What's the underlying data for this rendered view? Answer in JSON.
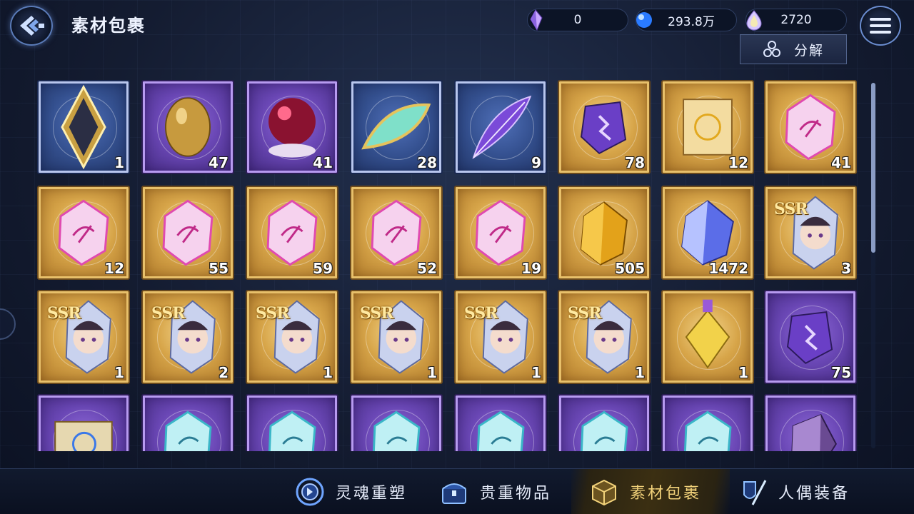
{
  "header": {
    "title": "素材包裹",
    "decompose_label": "分解"
  },
  "currencies": [
    {
      "icon": "crystal-shard-icon",
      "value": "0"
    },
    {
      "icon": "blue-orb-icon",
      "value": "293.8万"
    },
    {
      "icon": "gem-drop-icon",
      "value": "2720"
    }
  ],
  "items": [
    {
      "name": "mirror-frame",
      "rarity": "blue",
      "count": "1"
    },
    {
      "name": "golden-egg",
      "rarity": "purple",
      "count": "47"
    },
    {
      "name": "crimson-orb",
      "rarity": "purple",
      "count": "41"
    },
    {
      "name": "jade-leaf",
      "rarity": "blue",
      "count": "28"
    },
    {
      "name": "violet-quill",
      "rarity": "blue",
      "count": "9"
    },
    {
      "name": "purple-rune-stone",
      "rarity": "gold",
      "count": "78"
    },
    {
      "name": "golden-scroll",
      "rarity": "gold",
      "count": "12"
    },
    {
      "name": "pink-rune-crystal",
      "rarity": "gold",
      "count": "41"
    },
    {
      "name": "pink-rune-crystal",
      "rarity": "gold",
      "count": "12"
    },
    {
      "name": "pink-rune-crystal",
      "rarity": "gold",
      "count": "55"
    },
    {
      "name": "pink-rune-crystal",
      "rarity": "gold",
      "count": "59"
    },
    {
      "name": "pink-rune-crystal",
      "rarity": "gold",
      "count": "52"
    },
    {
      "name": "pink-rune-crystal",
      "rarity": "gold",
      "count": "19"
    },
    {
      "name": "amber-gem",
      "rarity": "gold",
      "count": "505"
    },
    {
      "name": "blue-crystal",
      "rarity": "gold",
      "count": "1472"
    },
    {
      "name": "ssr-portrait-crystal",
      "rarity": "gold",
      "count": "3",
      "badge": "SSR"
    },
    {
      "name": "ssr-portrait-crystal",
      "rarity": "gold",
      "count": "1",
      "badge": "SSR"
    },
    {
      "name": "ssr-portrait-crystal",
      "rarity": "gold",
      "count": "2",
      "badge": "SSR"
    },
    {
      "name": "ssr-portrait-crystal",
      "rarity": "gold",
      "count": "1",
      "badge": "SSR"
    },
    {
      "name": "ssr-portrait-crystal",
      "rarity": "gold",
      "count": "1",
      "badge": "SSR"
    },
    {
      "name": "ssr-portrait-crystal",
      "rarity": "gold",
      "count": "1",
      "badge": "SSR"
    },
    {
      "name": "ssr-portrait-crystal",
      "rarity": "gold",
      "count": "1",
      "badge": "SSR"
    },
    {
      "name": "golden-potion",
      "rarity": "gold",
      "count": "1"
    },
    {
      "name": "purple-rune-stone",
      "rarity": "purple",
      "count": "75"
    },
    {
      "name": "blue-scroll",
      "rarity": "purple",
      "count": ""
    },
    {
      "name": "cyan-rune-crystal",
      "rarity": "purple",
      "count": ""
    },
    {
      "name": "cyan-rune-crystal",
      "rarity": "purple",
      "count": ""
    },
    {
      "name": "cyan-rune-crystal",
      "rarity": "purple",
      "count": ""
    },
    {
      "name": "cyan-rune-crystal",
      "rarity": "purple",
      "count": ""
    },
    {
      "name": "cyan-rune-crystal",
      "rarity": "purple",
      "count": ""
    },
    {
      "name": "cyan-rune-crystal",
      "rarity": "purple",
      "count": ""
    },
    {
      "name": "violet-ore",
      "rarity": "purple",
      "count": ""
    }
  ],
  "tabs": [
    {
      "label": "灵魂重塑",
      "icon": "soul-reshape-icon",
      "active": false
    },
    {
      "label": "贵重物品",
      "icon": "treasure-chest-icon",
      "active": false
    },
    {
      "label": "素材包裹",
      "icon": "material-box-icon",
      "active": true
    },
    {
      "label": "人偶装备",
      "icon": "doll-equipment-icon",
      "active": false
    }
  ]
}
